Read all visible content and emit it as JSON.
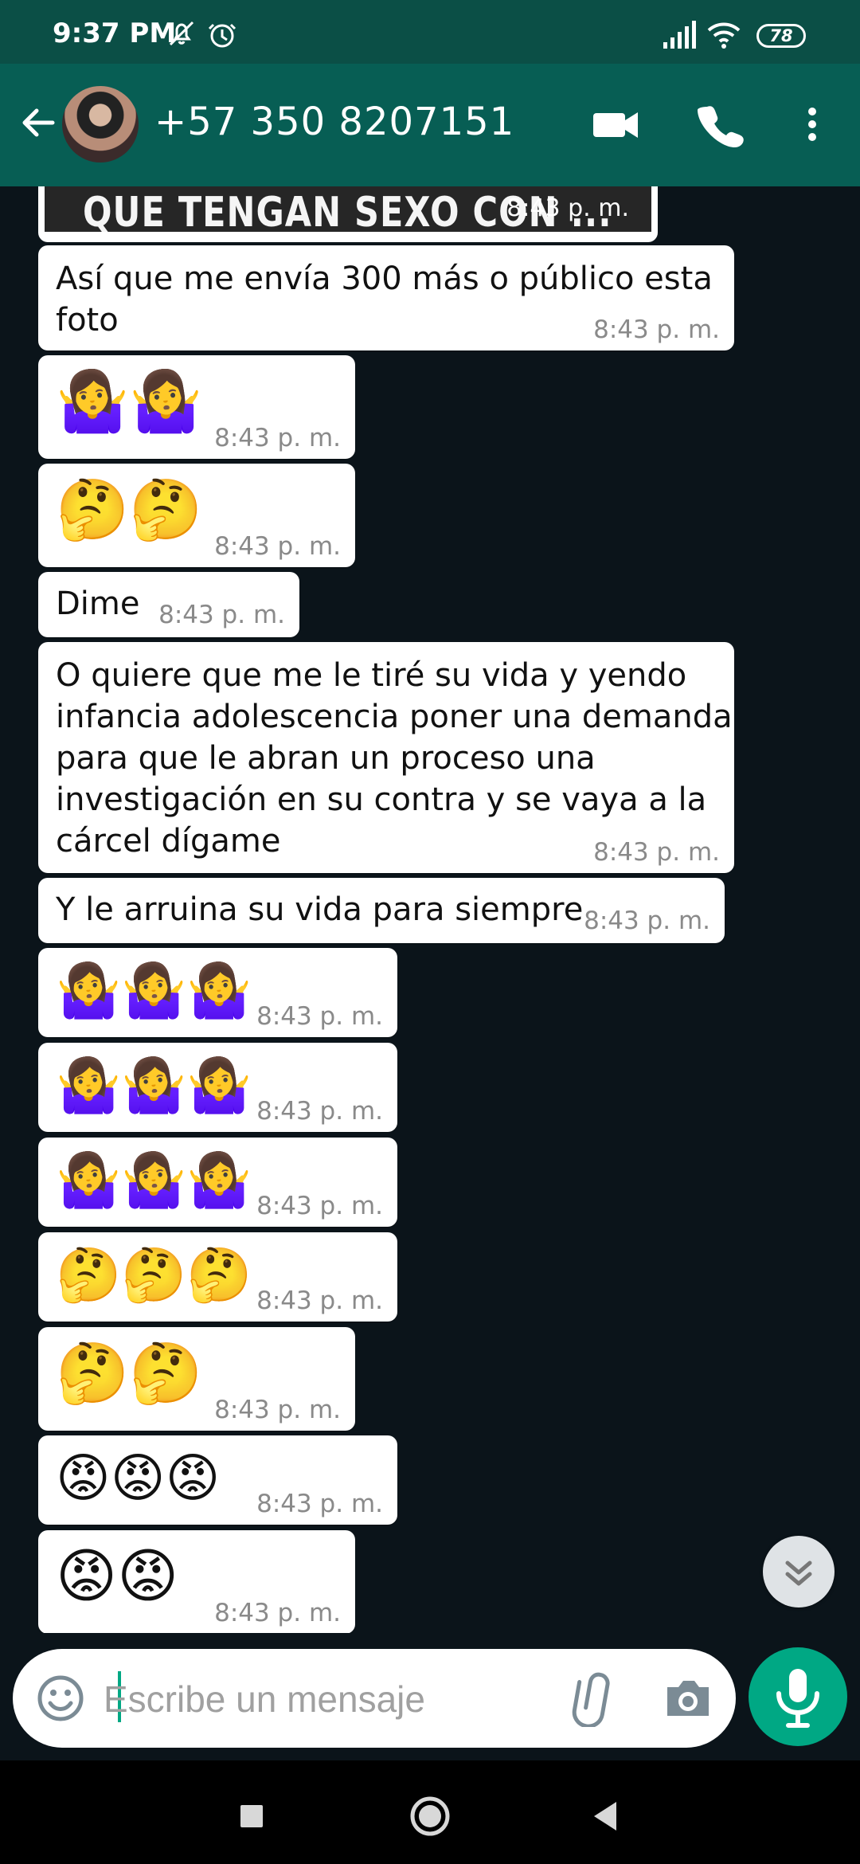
{
  "status_bar": {
    "time": "9:37 PM",
    "icons": [
      "mute-icon",
      "alarm-icon",
      "signal-icon",
      "wifi-icon",
      "battery-icon"
    ],
    "battery": "78"
  },
  "app_bar": {
    "contact_name": "+57 350 8207151",
    "icons": [
      "back-arrow-icon",
      "contact-avatar",
      "video-call-icon",
      "voice-call-icon",
      "more-options-icon"
    ],
    "colors": {
      "status": "#0b4f46",
      "header": "#075e54",
      "accent": "#00a884",
      "chat_background": "#0b141a"
    }
  },
  "top_media": {
    "caption": "QUE TENGAN SEXO CON ...",
    "time": "8:43 p. m."
  },
  "messages": [
    {
      "kind": "text",
      "text": "Así que me envía 300 más o público esta\nfoto",
      "time": "8:43 p. m."
    },
    {
      "kind": "emoji",
      "emoji": "🤷‍♀️🤷‍♀️",
      "time": "8:43 p. m."
    },
    {
      "kind": "emoji",
      "emoji": "🤔🤔",
      "time": "8:43 p. m."
    },
    {
      "kind": "text",
      "text": "Dime",
      "time": "8:43 p. m."
    },
    {
      "kind": "text",
      "text": "O quiere que me le tiré su vida y yendo\ninfancia adolescencia poner una demanda\npara que le abran un proceso una\ninvestigación en su contra y se vaya a la\ncárcel dígame",
      "time": "8:43 p. m."
    },
    {
      "kind": "text",
      "text": "Y le arruina su vida para siempre",
      "time": "8:43 p. m."
    },
    {
      "kind": "emoji",
      "emoji": "🤷‍♀️🤷‍♀️🤷‍♀️",
      "time": "8:43 p. m."
    },
    {
      "kind": "emoji",
      "emoji": "🤷‍♀️🤷‍♀️🤷‍♀️",
      "time": "8:43 p. m."
    },
    {
      "kind": "emoji",
      "emoji": "🤷‍♀️🤷‍♀️🤷‍♀️",
      "time": "8:43 p. m."
    },
    {
      "kind": "emoji",
      "emoji": "🤔🤔🤔",
      "time": "8:43 p. m."
    },
    {
      "kind": "emoji",
      "emoji": "🤔🤔",
      "time": "8:43 p. m."
    },
    {
      "kind": "emoji",
      "emoji": "😡😡😡",
      "time": "8:43 p. m."
    },
    {
      "kind": "emoji",
      "emoji": "😡😡",
      "time": "8:43 p. m."
    }
  ],
  "composer": {
    "placeholder": "Escribe un mensaje",
    "icons": [
      "emoji-icon",
      "attach-icon",
      "camera-icon",
      "microphone-icon"
    ]
  },
  "floating_button": {
    "icon": "scroll-down-icon"
  },
  "system_nav": {
    "icons": [
      "recent-apps-icon",
      "home-icon",
      "back-icon"
    ]
  }
}
